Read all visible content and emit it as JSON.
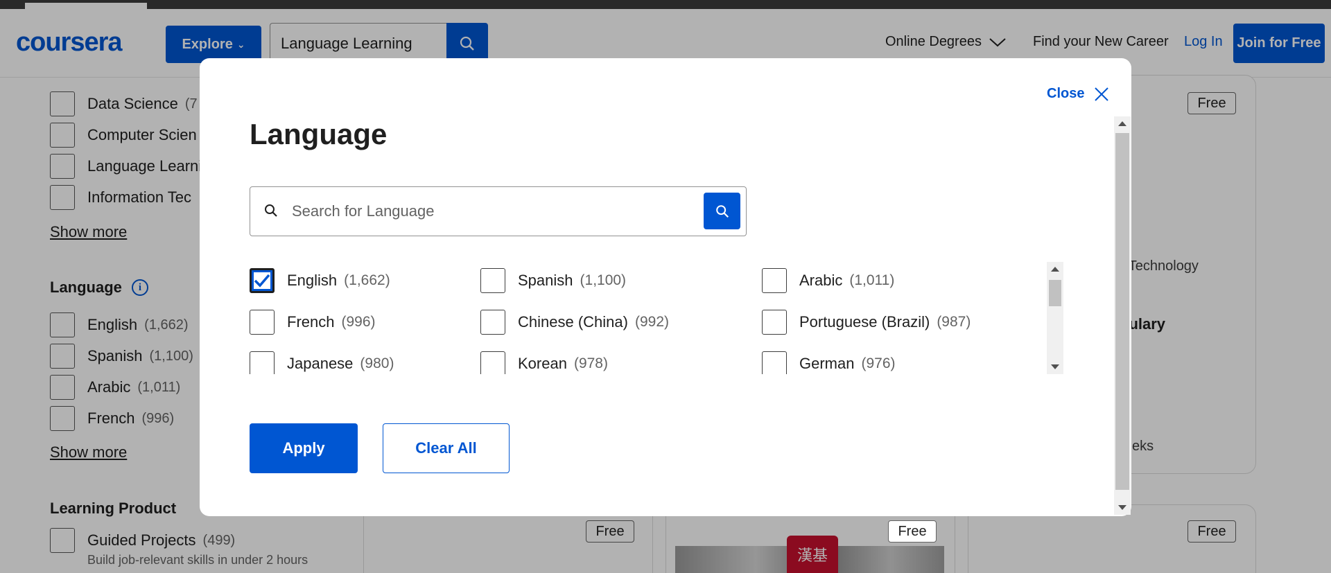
{
  "header": {
    "logo": "coursera",
    "explore_label": "Explore",
    "search_value": "Language Learning",
    "nav_online_degrees": "Online Degrees",
    "nav_find_career": "Find your New Career",
    "login": "Log In",
    "join": "Join for Free"
  },
  "filters": {
    "subject_items": [
      {
        "label": "Data Science",
        "count": "(7"
      },
      {
        "label": "Computer Scien"
      },
      {
        "label": "Language Learni"
      },
      {
        "label": "Information Tec"
      }
    ],
    "subject_show_more": "Show more",
    "language_heading": "Language",
    "language_items": [
      {
        "label": "English",
        "count": "(1,662)"
      },
      {
        "label": "Spanish",
        "count": "(1,100)"
      },
      {
        "label": "Arabic",
        "count": "(1,011)"
      },
      {
        "label": "French",
        "count": "(996)"
      }
    ],
    "language_show_more": "Show more",
    "learning_product_heading": "Learning Product",
    "guided_projects": {
      "label": "Guided Projects",
      "count": "(499)",
      "sub": "Build job-relevant skills in under 2 hours"
    }
  },
  "cards": {
    "free_label": "Free",
    "partial_text_1": "f Technology",
    "partial_text_2": "bulary",
    "partial_text_3": "eks",
    "seal_text": "漢基"
  },
  "modal": {
    "close_label": "Close",
    "title": "Language",
    "search_placeholder": "Search for Language",
    "languages": [
      {
        "label": "English",
        "count": "(1,662)",
        "checked": true
      },
      {
        "label": "Spanish",
        "count": "(1,100)",
        "checked": false
      },
      {
        "label": "Arabic",
        "count": "(1,011)",
        "checked": false
      },
      {
        "label": "French",
        "count": "(996)",
        "checked": false
      },
      {
        "label": "Chinese (China)",
        "count": "(992)",
        "checked": false
      },
      {
        "label": "Portuguese (Brazil)",
        "count": "(987)",
        "checked": false
      },
      {
        "label": "Japanese",
        "count": "(980)",
        "checked": false
      },
      {
        "label": "Korean",
        "count": "(978)",
        "checked": false
      },
      {
        "label": "German",
        "count": "(976)",
        "checked": false
      }
    ],
    "apply_label": "Apply",
    "clear_label": "Clear All"
  },
  "colors": {
    "brand_blue": "#0056d2",
    "overlay": "rgba(0,0,0,0.3)"
  }
}
